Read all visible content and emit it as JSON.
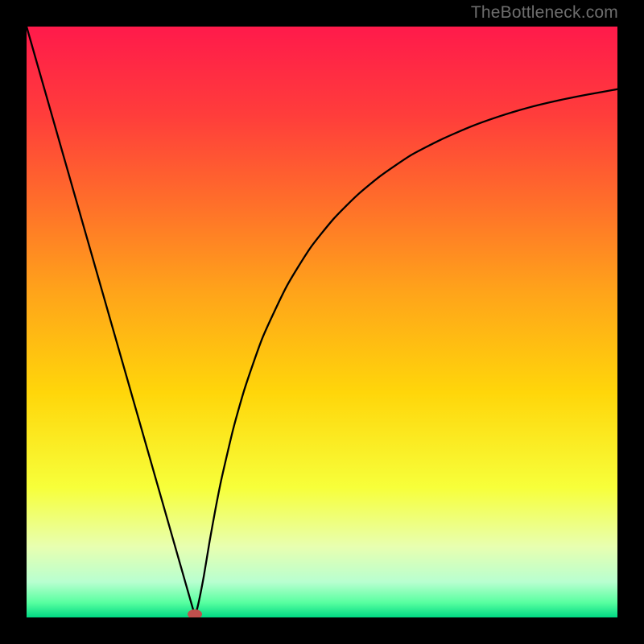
{
  "watermark": {
    "text": "TheBottleneck.com"
  },
  "chart_data": {
    "type": "line",
    "title": "",
    "xlabel": "",
    "ylabel": "",
    "xlim": [
      0,
      100
    ],
    "ylim": [
      0,
      100
    ],
    "grid": false,
    "background_gradient": {
      "direction": "vertical",
      "stops": [
        {
          "pos": 0.0,
          "color": "#ff1a4b"
        },
        {
          "pos": 0.15,
          "color": "#ff3d3b"
        },
        {
          "pos": 0.3,
          "color": "#ff6f2a"
        },
        {
          "pos": 0.45,
          "color": "#ffa41a"
        },
        {
          "pos": 0.62,
          "color": "#ffd60a"
        },
        {
          "pos": 0.78,
          "color": "#f7ff3a"
        },
        {
          "pos": 0.88,
          "color": "#e8ffb0"
        },
        {
          "pos": 0.94,
          "color": "#b8ffd0"
        },
        {
          "pos": 0.975,
          "color": "#58ffa0"
        },
        {
          "pos": 1.0,
          "color": "#00d983"
        }
      ]
    },
    "series": [
      {
        "name": "bottleneck-curve",
        "color": "#000000",
        "stroke_width": 2.3,
        "x": [
          0,
          2,
          4,
          6,
          8,
          10,
          12,
          14,
          16,
          18,
          20,
          22,
          24,
          26,
          27,
          28,
          28.5,
          29,
          30,
          31,
          32,
          33,
          35,
          37,
          40,
          44,
          48,
          52,
          56,
          60,
          65,
          70,
          75,
          80,
          85,
          90,
          95,
          100
        ],
        "y": [
          100,
          93,
          86,
          79,
          72,
          65,
          58,
          51,
          44,
          37,
          30,
          23,
          16,
          9,
          5.5,
          2,
          0.5,
          2,
          7,
          13,
          18.5,
          23.5,
          32,
          39,
          47.5,
          56,
          62.5,
          67.5,
          71.5,
          74.8,
          78.2,
          80.8,
          83,
          84.8,
          86.3,
          87.5,
          88.5,
          89.4
        ]
      }
    ],
    "markers": [
      {
        "name": "optimal-point",
        "x": 28.5,
        "y": 0.5,
        "color": "#c0504d",
        "rx": 9,
        "ry": 6
      }
    ]
  }
}
